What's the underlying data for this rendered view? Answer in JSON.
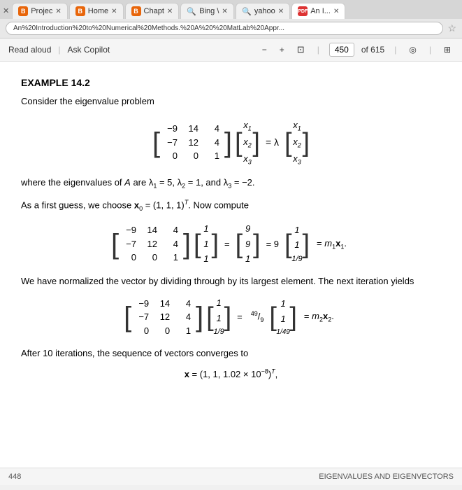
{
  "browser": {
    "tabs": [
      {
        "id": "projec",
        "label": "Projec",
        "icon": "B",
        "icon_type": "orange",
        "active": false
      },
      {
        "id": "home",
        "label": "Home",
        "icon": "B",
        "icon_type": "orange",
        "active": false
      },
      {
        "id": "chapt",
        "label": "Chapt",
        "icon": "B",
        "icon_type": "orange",
        "active": false
      },
      {
        "id": "bing",
        "label": "Bing \\",
        "icon": "Q",
        "icon_type": "search",
        "active": false
      },
      {
        "id": "yahoo",
        "label": "yahoo",
        "icon": "Q",
        "icon_type": "search",
        "active": false
      },
      {
        "id": "an",
        "label": "An I...",
        "icon": "PDF",
        "icon_type": "red",
        "active": true
      }
    ],
    "address": "An%20Introduction%20to%20Numerical%20Methods.%20A%20%20MatLab%20Appr...",
    "star_icon": "☆"
  },
  "toolbar": {
    "read_aloud": "Read aloud",
    "ask_copilot": "Ask Copilot",
    "minus": "−",
    "plus": "+",
    "fit_icon": "⊡",
    "page_number": "450",
    "page_of": "of 615",
    "speaker_icon": "◎",
    "layout_icon": "⊞"
  },
  "content": {
    "example_number": "EXAMPLE 14.2",
    "intro_text": "Consider the eigenvalue problem",
    "eigenvalues_text": "where the eigenvalues of A are λ₁ = 5, λ₂ = 1, and λ₃ = −2.",
    "para1": "As a first guess, we choose x₀ = (1, 1, 1)ᵀ. Now compute",
    "para2": "We have normalized the vector by dividing through by its largest element. The next iteration yields",
    "para3": "After 10 iterations, the sequence of vectors converges to",
    "converge_eq": "x = (1, 1, 1.02 × 10⁻⁸)ᵀ,",
    "matrix_A": [
      [
        -9,
        14,
        4
      ],
      [
        -7,
        12,
        4
      ],
      [
        0,
        0,
        1
      ]
    ],
    "vector_x": [
      "x₁",
      "x₂",
      "x₃"
    ],
    "vector_x_eq": [
      "x₁",
      "x₂",
      "x₃"
    ],
    "eq1_result": [
      9,
      9,
      1
    ],
    "eq1_m1x1": "m₁x₁",
    "vec_111": [
      1,
      1,
      1
    ],
    "vec_991": [
      "9",
      "9",
      "1"
    ],
    "vec_1_1_1o9": [
      "1",
      "1",
      "1/9"
    ],
    "iteration2_lhs_vec": [
      "1",
      "1",
      "1/9"
    ],
    "iteration2_result_num": "49",
    "iteration2_result_den": "9",
    "iteration2_rhs_vec": [
      "1",
      "1",
      "1/49"
    ],
    "iteration2_m2x2": "m₂x₂",
    "footer_left": "448",
    "footer_right": "EIGENVALUES AND EIGENVECTORS"
  }
}
